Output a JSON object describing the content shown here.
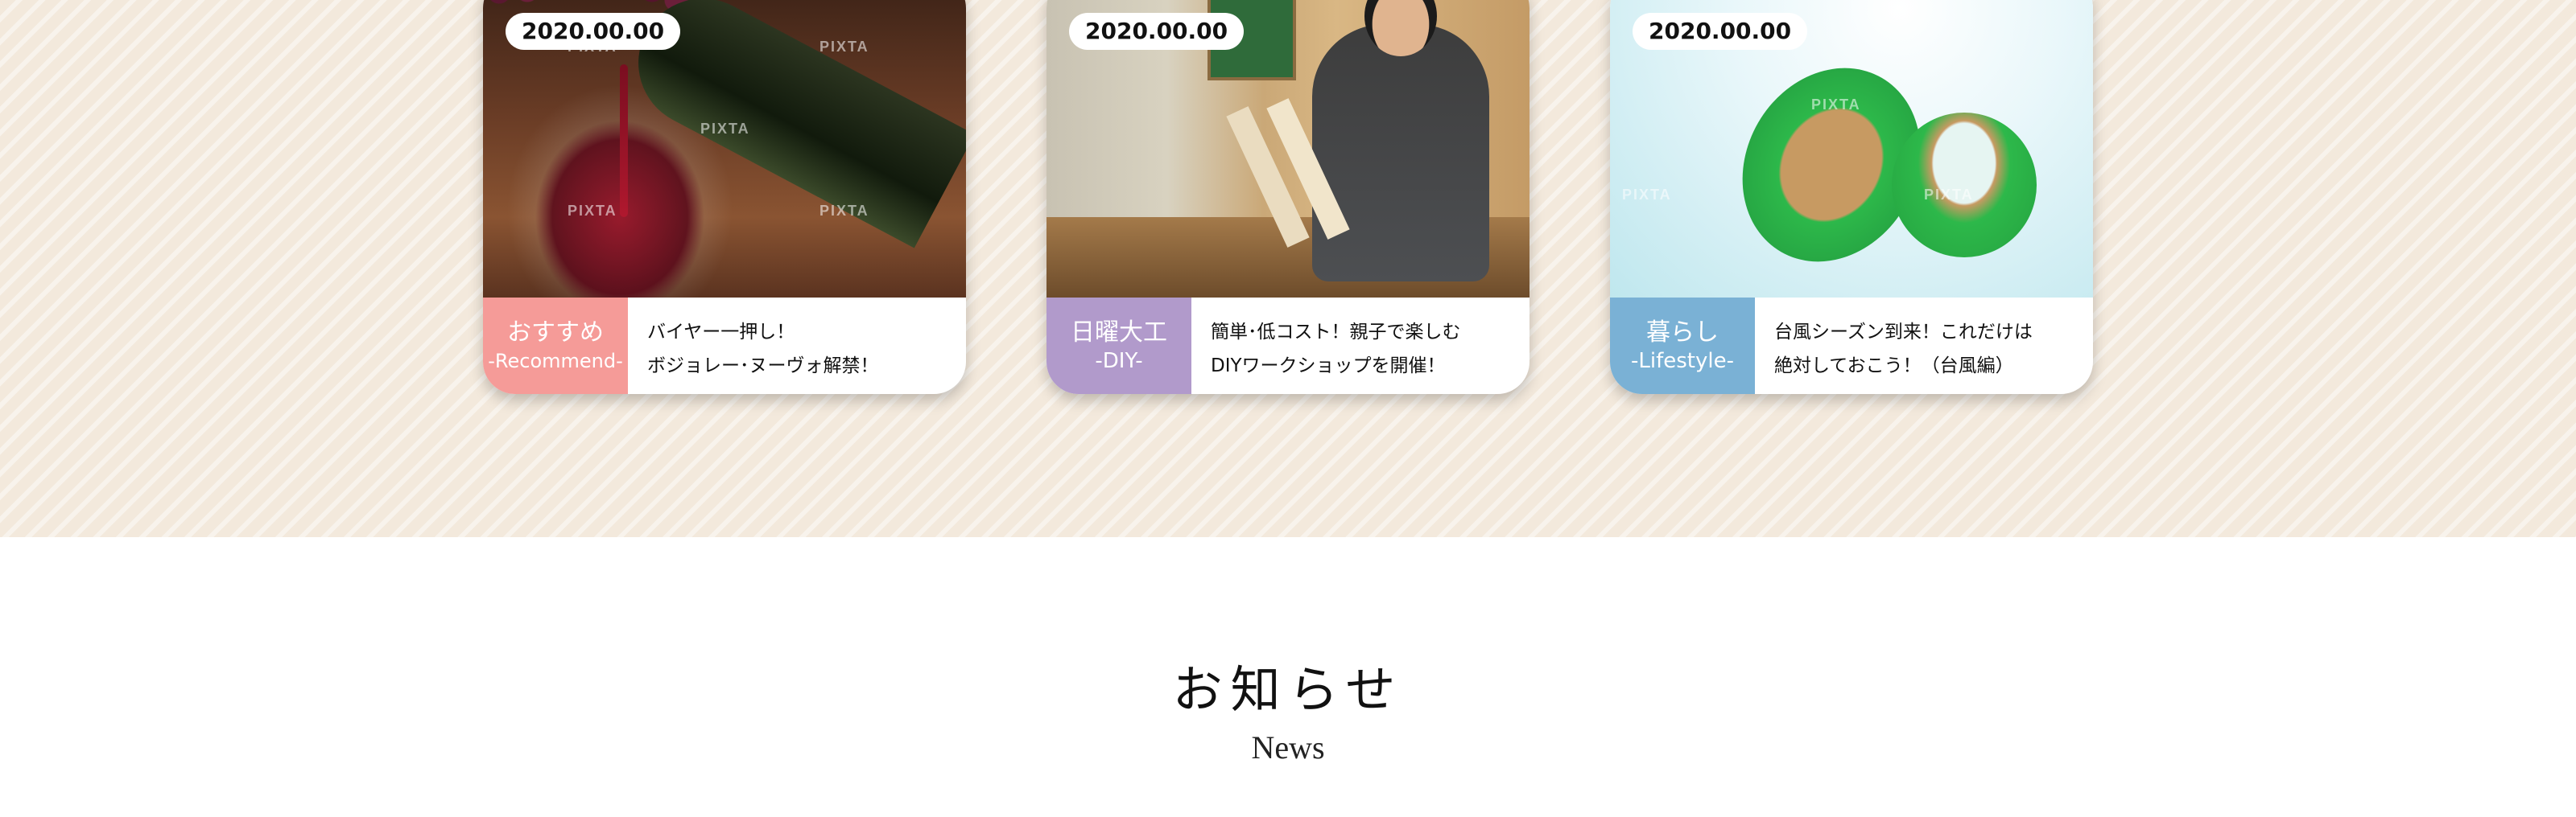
{
  "cards": [
    {
      "date": "2020.00.00",
      "category_jp": "おすすめ",
      "category_en": "-Recommend-",
      "text_line1": "バイヤー一押し！",
      "text_line2": "ボジョレー･ヌーヴォ解禁！",
      "image": "wine-pouring-photo",
      "category_color": "#f59b98"
    },
    {
      "date": "2020.00.00",
      "category_jp": "日曜大工",
      "category_en": "-DIY-",
      "text_line1": "簡単･低コスト！親子で楽しむ",
      "text_line2": "DIYワークショップを開催！",
      "image": "diy-workshop-photo",
      "category_color": "#b19acb"
    },
    {
      "date": "2020.00.00",
      "category_jp": "暮らし",
      "category_en": "-Lifestyle-",
      "text_line1": "台風シーズン到来！これだけは",
      "text_line2": "絶対しておこう！（台風編）",
      "image": "green-tape-photo",
      "category_color": "#7ab1d5"
    }
  ],
  "watermark_text": "PIXTA",
  "news": {
    "title_jp": "お知らせ",
    "title_en": "News"
  },
  "colors": {
    "section_background": "#f3e9dc"
  }
}
